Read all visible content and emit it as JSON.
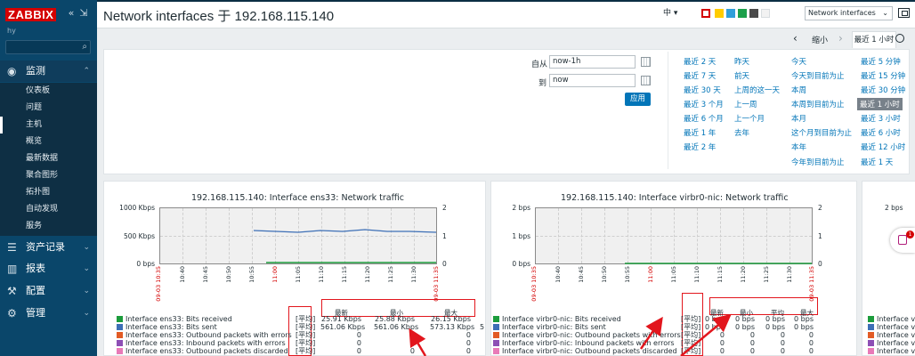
{
  "sidebar": {
    "logo": "ZABBIX",
    "hostname": "hy",
    "collapse_icon": "«",
    "kiosk_icon": "⇲",
    "monitor": {
      "label": "监测",
      "icon": "eye-icon"
    },
    "monitor_items": [
      "仪表板",
      "问题",
      "主机",
      "概览",
      "最新数据",
      "聚合图形",
      "拓扑图",
      "自动发现",
      "服务"
    ],
    "others": [
      {
        "label": "资产记录",
        "icon": "list-icon"
      },
      {
        "label": "报表",
        "icon": "chart-icon"
      },
      {
        "label": "配置",
        "icon": "wrench-icon"
      },
      {
        "label": "管理",
        "icon": "gear-icon"
      }
    ]
  },
  "header": {
    "title": "Network interfaces 于 192.168.115.140",
    "language": "中 ▾",
    "swatches": [
      "#ffffff",
      "#ffcc00",
      "#2f9fdb",
      "#1ca04b",
      "#4a4a4a",
      "#f2f2f2"
    ],
    "view_select": "Network interfaces",
    "kiosk_icon": "fullscreen-icon"
  },
  "timenav": {
    "zoom_out": "缩小",
    "active_tab": "最近 1 小时",
    "prev": "‹",
    "next": "›"
  },
  "filter": {
    "from_label": "自从",
    "from_value": "now-1h",
    "to_label": "到",
    "to_value": "now",
    "apply": "应用",
    "quick_col1": [
      "最近 2 天",
      "最近 7 天",
      "最近 30 天",
      "最近 3 个月",
      "最近 6 个月",
      "最近 1 年",
      "最近 2 年"
    ],
    "quick_col2": [
      "昨天",
      "前天",
      "上周的这一天",
      "上一周",
      "上一个月",
      "去年"
    ],
    "quick_col3": [
      "今天",
      "今天到目前为止",
      "本周",
      "本周到目前为止",
      "本月",
      "这个月到目前为止",
      "本年",
      "今年到目前为止"
    ],
    "quick_col4": [
      "最近 5 分钟",
      "最近 15 分钟",
      "最近 30 分钟",
      "最近 1 小时",
      "最近 3 小时",
      "最近 6 小时",
      "最近 12 小时",
      "最近 1 天"
    ]
  },
  "graph1": {
    "title": "192.168.115.140: Interface ens33: Network traffic",
    "y_left": [
      "1000 Kbps",
      "500 Kbps",
      "0 bps"
    ],
    "y_right": [
      "2",
      "1",
      "0"
    ],
    "x_ticks": [
      "09-03 10:35",
      "10:40",
      "10:45",
      "10:50",
      "10:55",
      "11:00",
      "11:05",
      "11:10",
      "11:15",
      "11:20",
      "11:25",
      "11:30",
      "09-03 11:35"
    ],
    "col_heads": [
      "最新",
      "最小",
      "最大"
    ],
    "bracket": "[平均]",
    "legend": [
      {
        "color": "#1c9c3c",
        "name": "Interface ens33: Bits received",
        "v": [
          "25.91 Kbps",
          "25.88 Kbps",
          "26.15 Kbps"
        ]
      },
      {
        "color": "#3d6fb6",
        "name": "Interface ens33: Bits sent",
        "v": [
          "561.06 Kbps",
          "561.06 Kbps",
          "573.13 Kbps"
        ]
      },
      {
        "color": "#e25b25",
        "name": "Interface ens33: Outbound packets with errors",
        "v": [
          "0",
          "0",
          "0"
        ]
      },
      {
        "color": "#8d4fb5",
        "name": "Interface ens33: Inbound packets with errors",
        "v": [
          "0",
          "0",
          "0"
        ]
      },
      {
        "color": "#e87ab8",
        "name": "Interface ens33: Outbound packets discarded",
        "v": [
          "0",
          "0",
          "0"
        ]
      }
    ],
    "extra": "5"
  },
  "graph2": {
    "title": "192.168.115.140: Interface virbr0-nic: Network traffic",
    "y_left": [
      "2 bps",
      "1 bps",
      "0 bps"
    ],
    "y_right": [
      "2",
      "1",
      "0"
    ],
    "x_ticks": [
      "09-03 10:35",
      "10:40",
      "10:45",
      "10:50",
      "10:55",
      "11:00",
      "11:05",
      "11:10",
      "11:15",
      "11:20",
      "11:25",
      "11:30",
      "09-03 11:35"
    ],
    "col_heads": [
      "最新",
      "最小",
      "平均",
      "最大"
    ],
    "bracket": "[平均]",
    "legend": [
      {
        "color": "#1c9c3c",
        "name": "Interface virbr0-nic: Bits received",
        "v": [
          "0 bps",
          "0 bps",
          "0 bps",
          "0 bps"
        ]
      },
      {
        "color": "#3d6fb6",
        "name": "Interface virbr0-nic: Bits sent",
        "v": [
          "0 bps",
          "0 bps",
          "0 bps",
          "0 bps"
        ]
      },
      {
        "color": "#e25b25",
        "name": "Interface virbr0-nic: Outbound packets with errors",
        "v": [
          "0",
          "0",
          "0",
          "0"
        ]
      },
      {
        "color": "#8d4fb5",
        "name": "Interface virbr0-nic: Inbound packets with errors",
        "v": [
          "0",
          "0",
          "0",
          "0"
        ]
      },
      {
        "color": "#e87ab8",
        "name": "Interface virbr0-nic: Outbound packets discarded",
        "v": [
          "0",
          "0",
          "0",
          "0"
        ]
      }
    ]
  },
  "graph3": {
    "y_left": "2 bps",
    "legend": [
      "Interface vi",
      "Interface vi",
      "Interface vi",
      "Interface vi",
      "Interface vi"
    ]
  },
  "float_badge": "1"
}
